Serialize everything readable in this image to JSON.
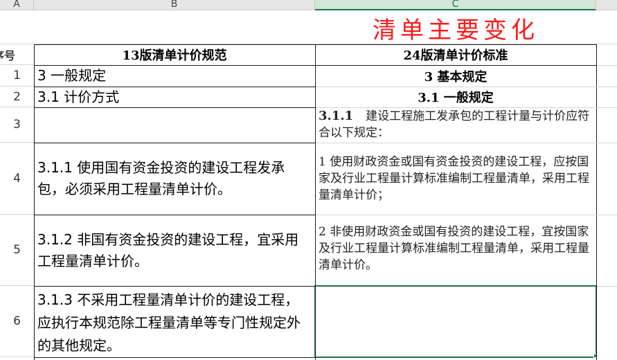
{
  "columns": [
    "A",
    "B",
    "C"
  ],
  "title": "清单主要变化",
  "header": {
    "rownum": "序号",
    "b": "13版清单计价规范",
    "c": "24版清单计价标准"
  },
  "rows": [
    {
      "num": "1",
      "b": "3 一般规定",
      "c": "3 基本规定"
    },
    {
      "num": "2",
      "b": "3.1 计价方式",
      "c": "3.1 一般规定"
    },
    {
      "num": "3",
      "b": "",
      "c_bold": "3.1.1",
      "c": "建设工程施工发承包的工程计量与计价应符合以下规定："
    },
    {
      "num": "4",
      "b": "3.1.1 使用国有资金投资的建设工程发承包，必须采用工程量清单计价。",
      "c": "1 使用财政资金或国有资金投资的建设工程，应按国家及行业工程量计算标准编制工程量清单，采用工程量清单计价；"
    },
    {
      "num": "5",
      "b": "3.1.2 非国有资金投资的建设工程，宜采用工程量清单计价。",
      "c": "2 非使用财政资金或国有投资的建设工程，宜按国家及行业工程量计算标准编制工程量清单，采用工程量清单计价。"
    },
    {
      "num": "6",
      "b": "3.1.3 不采用工程量清单计价的建设工程，应执行本规范除工程量清单等专门性规定外的其他规定。",
      "c": ""
    }
  ]
}
